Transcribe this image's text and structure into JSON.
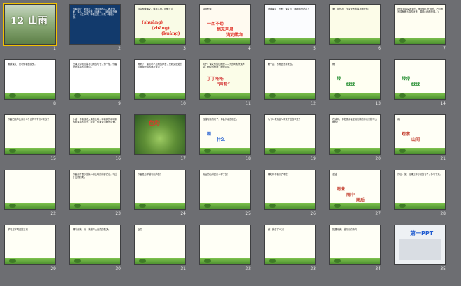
{
  "slides": [
    {
      "n": "1",
      "kind": "photo-title",
      "title": "12 山雨",
      "bg": "#7e9c6a"
    },
    {
      "n": "2",
      "kind": "navy-text",
      "text": "作者简介：赵丽宏，上海崇明岛人，著名作家、诗人。代表作有《诗魂》、《维纳斯在海上》、《生命草》等散文集，诗集《珊瑚》等。",
      "bg": "#123a6c",
      "color": "#ffffff"
    },
    {
      "n": "3",
      "kind": "text",
      "text": "自由朗读课文，读准字音，理解文意",
      "lines": [
        "(shuāng)",
        "(zhāng)",
        "(kuāng)"
      ],
      "accent": "#e0342a",
      "bg": "#f9fbe6"
    },
    {
      "n": "4",
      "kind": "text",
      "text": "词语积累",
      "lines": [
        "一丝不苟",
        "悄无声息",
        "清润柔和",
        "朦朦胧胧"
      ],
      "accent": "#e0342a",
      "bg": "#fffaf0"
    },
    {
      "n": "5",
      "kind": "text",
      "text": "默读课文，思考：课文写了哪两部分内容？",
      "accent": "#e0342a",
      "bg": "#fbfcfe"
    },
    {
      "n": "6",
      "kind": "text",
      "text": "第二自然段：作者是怎样描写雨来的？",
      "accent": "#c23a2a",
      "bg": "#fcfce8"
    },
    {
      "n": "7",
      "kind": "text",
      "text": "(他是用耳朵听到的，而是用心在倾听，把山雨写成有音乐感的声音，展现山雨的美感。)",
      "accent": "#c23a2a",
      "bg": "#fffef2"
    },
    {
      "n": "8",
      "kind": "text",
      "text": "朗读课文，思考作者的感受。",
      "bg": "#ffffff"
    },
    {
      "n": "9",
      "kind": "text",
      "text": "在课文中找出描写山雨的句子，想一想，作者是怎样描写山雨的。",
      "accent": "#d22d2d",
      "bg": "#ffffff"
    },
    {
      "n": "10",
      "kind": "text",
      "text": "雨来了，最初听不见雨的声音，只看见远处的山被轻纱似的雨雾笼罩了。",
      "bg": "#ffffff"
    },
    {
      "n": "11",
      "kind": "text",
      "text": "句子：课文写的山雨是——来的时候悄无声息；雨中的声音；雨停以后。",
      "lines": [
        "丁丁冬冬",
        "“声音”"
      ],
      "accent": "#d22d2d",
      "bg": "#fbfde8"
    },
    {
      "n": "12",
      "kind": "text",
      "text": "第一层：写雨是怎样来的。",
      "accent": "#1f5bd0",
      "bg": "#fffef6"
    },
    {
      "n": "13",
      "kind": "text",
      "text": "雨",
      "lines": [
        "绿",
        "绿绿"
      ],
      "accent": "#1d8a2a",
      "bg": "#fffff2"
    },
    {
      "n": "14",
      "kind": "text",
      "text": "",
      "lines": [
        "绿绿",
        "绿绿"
      ],
      "accent": "#1d8a2a",
      "bg": "#fffff6"
    },
    {
      "n": "15",
      "kind": "text",
      "text": "作者把雨声比作什么？这样写有什么好处？",
      "accent": "#c23a2a",
      "bg": "#fffff4"
    },
    {
      "n": "16",
      "kind": "text",
      "text": "小结：作者通过大量的比喻，将看到的和听到的景象描写出来，表现了作者对山雨的喜爱。",
      "accent": "#c23a2a",
      "bg": "#fffef2"
    },
    {
      "n": "17",
      "kind": "plant",
      "text": "",
      "lines": [
        "色彩"
      ],
      "accent": "#e0342a",
      "bg": "#6f9a4d"
    },
    {
      "n": "18",
      "kind": "text",
      "text": "找描写雨的句子，体会作者的感受。",
      "lines": [
        "雨",
        "什么"
      ],
      "accent": "#1f5bd0",
      "bg": "#fffef4"
    },
    {
      "n": "19",
      "kind": "text",
      "text": "为什么说雨给人带来了美的享受？",
      "accent": "#c23a2a",
      "bg": "#fffff6"
    },
    {
      "n": "20",
      "kind": "text",
      "text": "在读中，你发现作者是用怎样的方法来描写山雨的？",
      "accent": "#c23a2a",
      "bg": "#fffff6"
    },
    {
      "n": "21",
      "kind": "text",
      "text": "雨",
      "lines": [
        "观察",
        "山间"
      ],
      "accent": "#c23a2a",
      "bg": "#fffff6"
    },
    {
      "n": "22",
      "kind": "text",
      "text": "",
      "accent": "#e0342a",
      "bg": "#fffff6"
    },
    {
      "n": "23",
      "kind": "text",
      "text": "作者用了很多的拟人和比喻的修辞方法，写出了山雨的美。",
      "accent": "#c23a2a",
      "bg": "#fffef2"
    },
    {
      "n": "24",
      "kind": "text",
      "text": "作者是怎样描写雨声的？",
      "accent": "#c23a2a",
      "bg": "#fffff6"
    },
    {
      "n": "25",
      "kind": "text",
      "text": "雨后的山林是什么样子的？",
      "accent": "#c23a2a",
      "bg": "#fffff6"
    },
    {
      "n": "26",
      "kind": "text",
      "text": "课文中作者写了哪些？",
      "accent": "#c23a2a",
      "bg": "#fffff6"
    },
    {
      "n": "27",
      "kind": "text",
      "text": "总结",
      "lines": [
        "雨来",
        "雨中",
        "雨后"
      ],
      "accent": "#c23a2a",
      "bg": "#fffff6"
    },
    {
      "n": "28",
      "kind": "text",
      "text": "作业：找一找课文中写景的句子，抄写下来。",
      "accent": "#c23a2a",
      "bg": "#fffff6"
    },
    {
      "n": "29",
      "kind": "text",
      "text": "学习生字词语的生词",
      "accent": "#c23a2a",
      "bg": "#fffff6"
    },
    {
      "n": "30",
      "kind": "text",
      "text": "课外阅读：读一读描写大自然的散文。",
      "accent": "#c23a2a",
      "bg": "#fffff6"
    },
    {
      "n": "31",
      "kind": "text",
      "text": "板书",
      "accent": "#c23a2a",
      "bg": "#fffff6"
    },
    {
      "n": "32",
      "kind": "text",
      "text": "",
      "accent": "#c23a2a",
      "bg": "#fffff6"
    },
    {
      "n": "33",
      "kind": "text",
      "text": "读！我考了90分",
      "accent": "#c23a2a",
      "bg": "#fffff6"
    },
    {
      "n": "34",
      "kind": "text",
      "text": "拓展阅读：描写雨的诗句",
      "accent": "#1f5bd0",
      "bg": "#fffff6"
    },
    {
      "n": "35",
      "kind": "logo",
      "text": "第一PPT",
      "bg": "#eef1f4"
    }
  ]
}
